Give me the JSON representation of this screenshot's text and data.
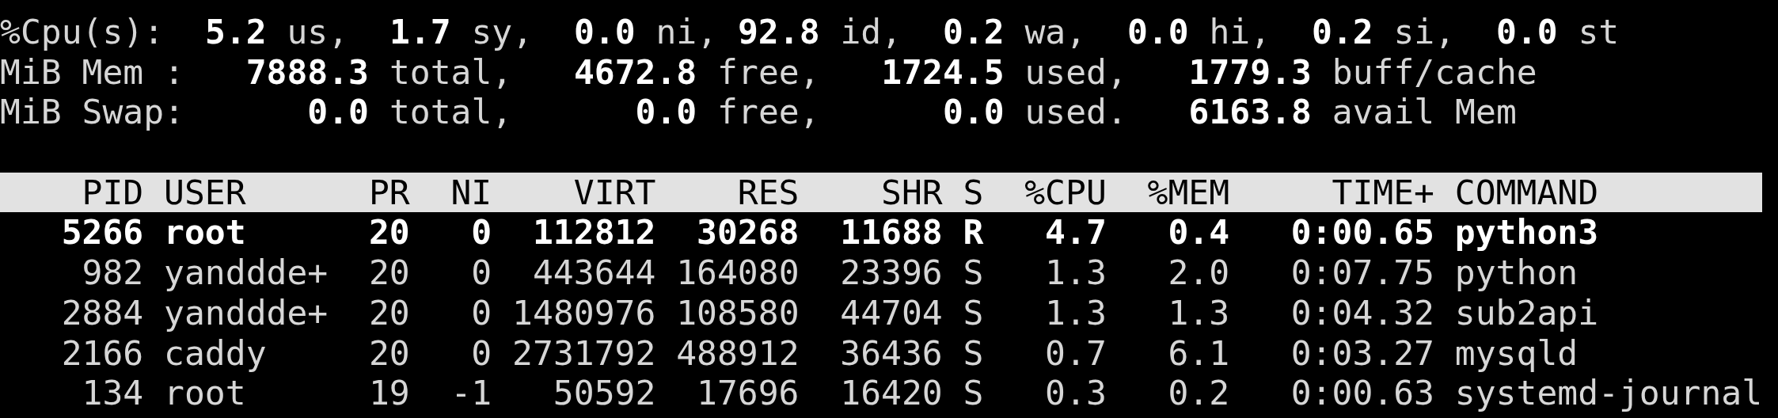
{
  "summary": [
    {
      "kind": "cpu",
      "prefix": "%Cpu(s):",
      "stats": [
        "**5.2** us,",
        "**1.7** sy,",
        "**0.0** ni,",
        "**92.8** id,",
        "**0.2** wa,",
        "**0.0** hi,",
        "**0.2** si,",
        "**0.0** st"
      ]
    },
    {
      "kind": "memory",
      "prefix": "MiB Mem :",
      "stats": [
        "**7888.3** total,",
        "**4672.8** free,",
        "**1724.5** used,",
        "**1779.3** buff/cache"
      ]
    },
    {
      "kind": "memory",
      "prefix": "MiB Swap:",
      "stats": [
        "**0.0** total,",
        "**0.0** free,",
        "**0.0** used.",
        "**6163.8** avail Mem"
      ]
    }
  ],
  "table": {
    "columns": [
      "PID",
      "USER",
      "PR",
      "NI",
      "VIRT",
      "RES",
      "SHR",
      "S",
      "%CPU",
      "%MEM",
      "TIME+",
      "COMMAND"
    ],
    "rows": [
      {
        "highlighted": true,
        "cells": [
          "5266",
          "root",
          "20",
          "0",
          "112812",
          "30268",
          "11688",
          "R",
          "4.7",
          "0.4",
          "0:00.65",
          "python3"
        ]
      },
      {
        "highlighted": false,
        "cells": [
          "982",
          "yanddde+",
          "20",
          "0",
          "443644",
          "164080",
          "23396",
          "S",
          "1.3",
          "2.0",
          "0:07.75",
          "python"
        ]
      },
      {
        "highlighted": false,
        "cells": [
          "2884",
          "yanddde+",
          "20",
          "0",
          "1480976",
          "108580",
          "44704",
          "S",
          "1.3",
          "1.3",
          "0:04.32",
          "sub2api"
        ]
      },
      {
        "highlighted": false,
        "cells": [
          "2166",
          "caddy",
          "20",
          "0",
          "2731792",
          "488912",
          "36436",
          "S",
          "0.7",
          "6.1",
          "0:03.27",
          "mysqld"
        ]
      },
      {
        "highlighted": false,
        "cells": [
          "134",
          "root",
          "19",
          "-1",
          "50592",
          "17696",
          "16420",
          "S",
          "0.3",
          "0.2",
          "0:00.63",
          "systemd-journal"
        ]
      }
    ]
  }
}
